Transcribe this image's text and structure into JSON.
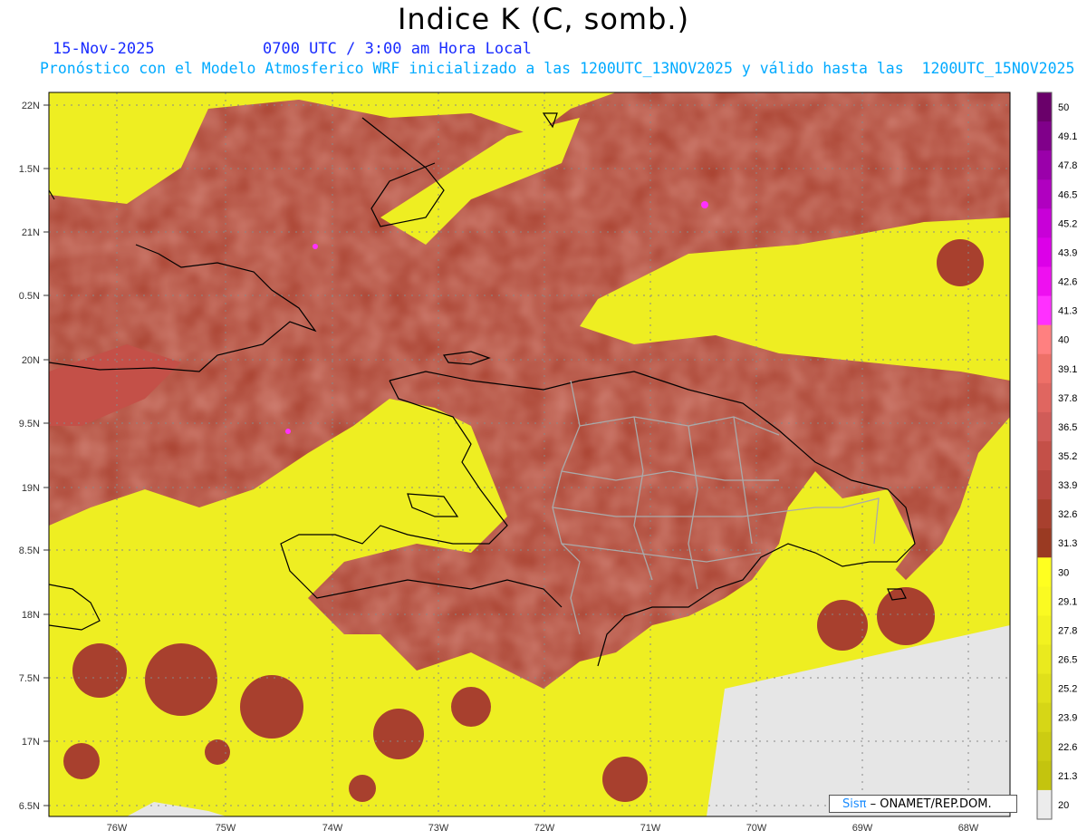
{
  "header": {
    "title": "Indice K (C, somb.)",
    "date": "15-Nov-2025",
    "valid_time": "0700 UTC / 3:00 am Hora Local",
    "model_line": "Pronóstico con el Modelo Atmosferico WRF inicializado a las 1200UTC_13NOV2025 y válido hasta las  1200UTC_15NOV2025"
  },
  "map": {
    "lat_labels": [
      "22N",
      "1.5N",
      "21N",
      "0.5N",
      "20N",
      "9.5N",
      "19N",
      "8.5N",
      "18N",
      "7.5N",
      "17N",
      "6.5N"
    ],
    "lon_labels": [
      "76W",
      "75W",
      "74W",
      "73W",
      "72W",
      "71W",
      "70W",
      "69W",
      "68W"
    ]
  },
  "colorbar": {
    "labels": [
      "50",
      "49.1",
      "47.8",
      "46.5",
      "45.2",
      "43.9",
      "42.6",
      "41.3",
      "40",
      "39.1",
      "37.8",
      "36.5",
      "35.2",
      "33.9",
      "32.6",
      "31.3",
      "30",
      "29.1",
      "27.8",
      "26.5",
      "25.2",
      "23.9",
      "22.6",
      "21.3",
      "20"
    ],
    "colors": [
      "#6a006a",
      "#80008a",
      "#9a00aa",
      "#b000c0",
      "#c800d8",
      "#dc00e8",
      "#ee10f0",
      "#ff30ff",
      "#ff8080",
      "#ee7068",
      "#e06660",
      "#d05c58",
      "#c45048",
      "#b84840",
      "#a8402e",
      "#9a3a22",
      "#ffff20",
      "#fafa22",
      "#f2f220",
      "#eaea1e",
      "#e0e01a",
      "#d6d616",
      "#cccc12",
      "#c4c40e",
      "#ececec"
    ]
  },
  "credit": {
    "prefix": "Sisπ",
    "text": "– ONAMET/REP.DOM."
  }
}
